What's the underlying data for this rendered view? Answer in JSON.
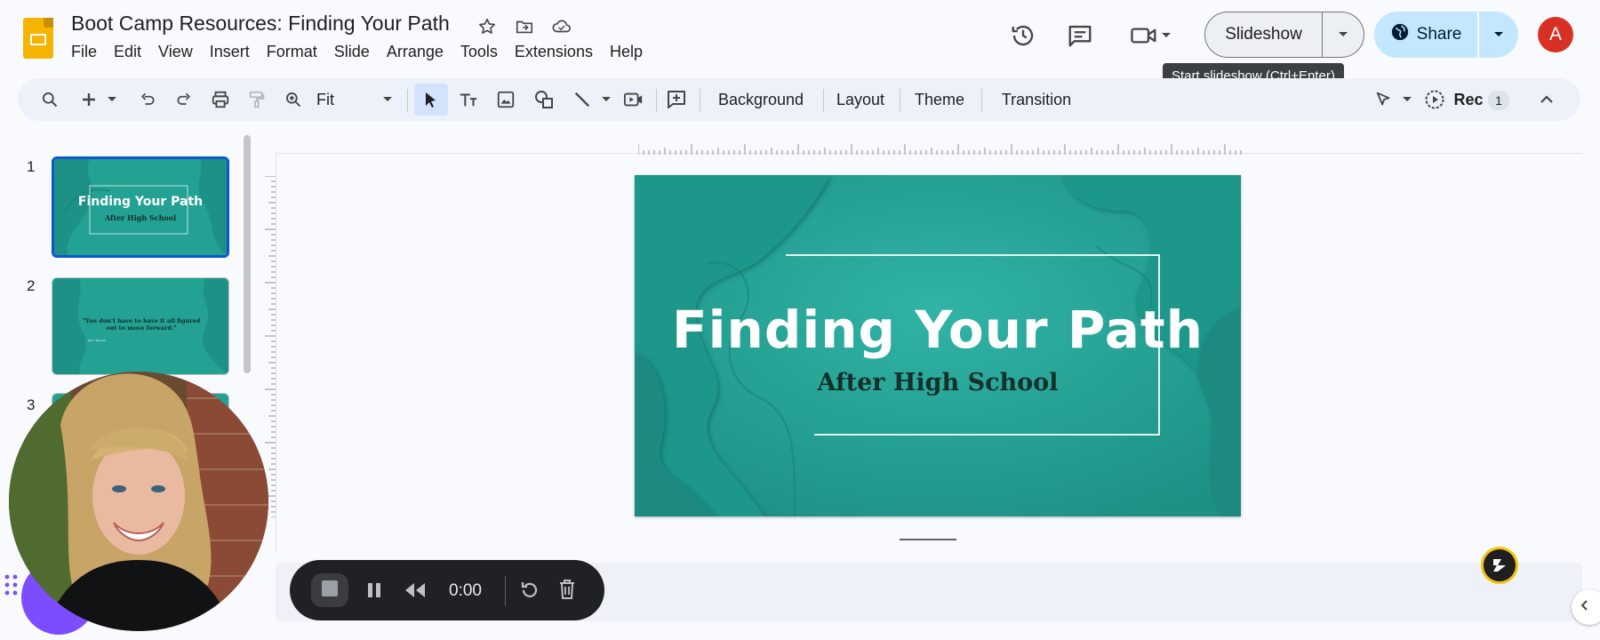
{
  "header": {
    "doc_title": "Boot Camp Resources: Finding Your Path",
    "menu": [
      "File",
      "Edit",
      "View",
      "Insert",
      "Format",
      "Slide",
      "Arrange",
      "Tools",
      "Extensions",
      "Help"
    ],
    "slideshow_label": "Slideshow",
    "share_label": "Share",
    "avatar_letter": "A",
    "tooltip": "Start slideshow (Ctrl+Enter)"
  },
  "toolbar": {
    "zoom_value": "Fit",
    "background_label": "Background",
    "layout_label": "Layout",
    "theme_label": "Theme",
    "transition_label": "Transition",
    "rec_label": "Rec",
    "rec_count": "1"
  },
  "slides_panel": {
    "numbers": [
      "1",
      "2",
      "3"
    ],
    "thumb1_title": "Finding Your Path",
    "thumb1_sub": "After High School",
    "thumb2_quote": "\"You don't have to have it all figured out to move forward.\"",
    "thumb2_attrib": "Roy T. Bennett"
  },
  "slide": {
    "title": "Finding Your Path",
    "subtitle": "After High School"
  },
  "recorder": {
    "time": "0:00"
  },
  "colors": {
    "teal": "#26a69a",
    "teal_dark": "#17857a",
    "accent_blue": "#0b57d0",
    "share_bg": "#c2e7ff",
    "avatar": "#d93025"
  }
}
